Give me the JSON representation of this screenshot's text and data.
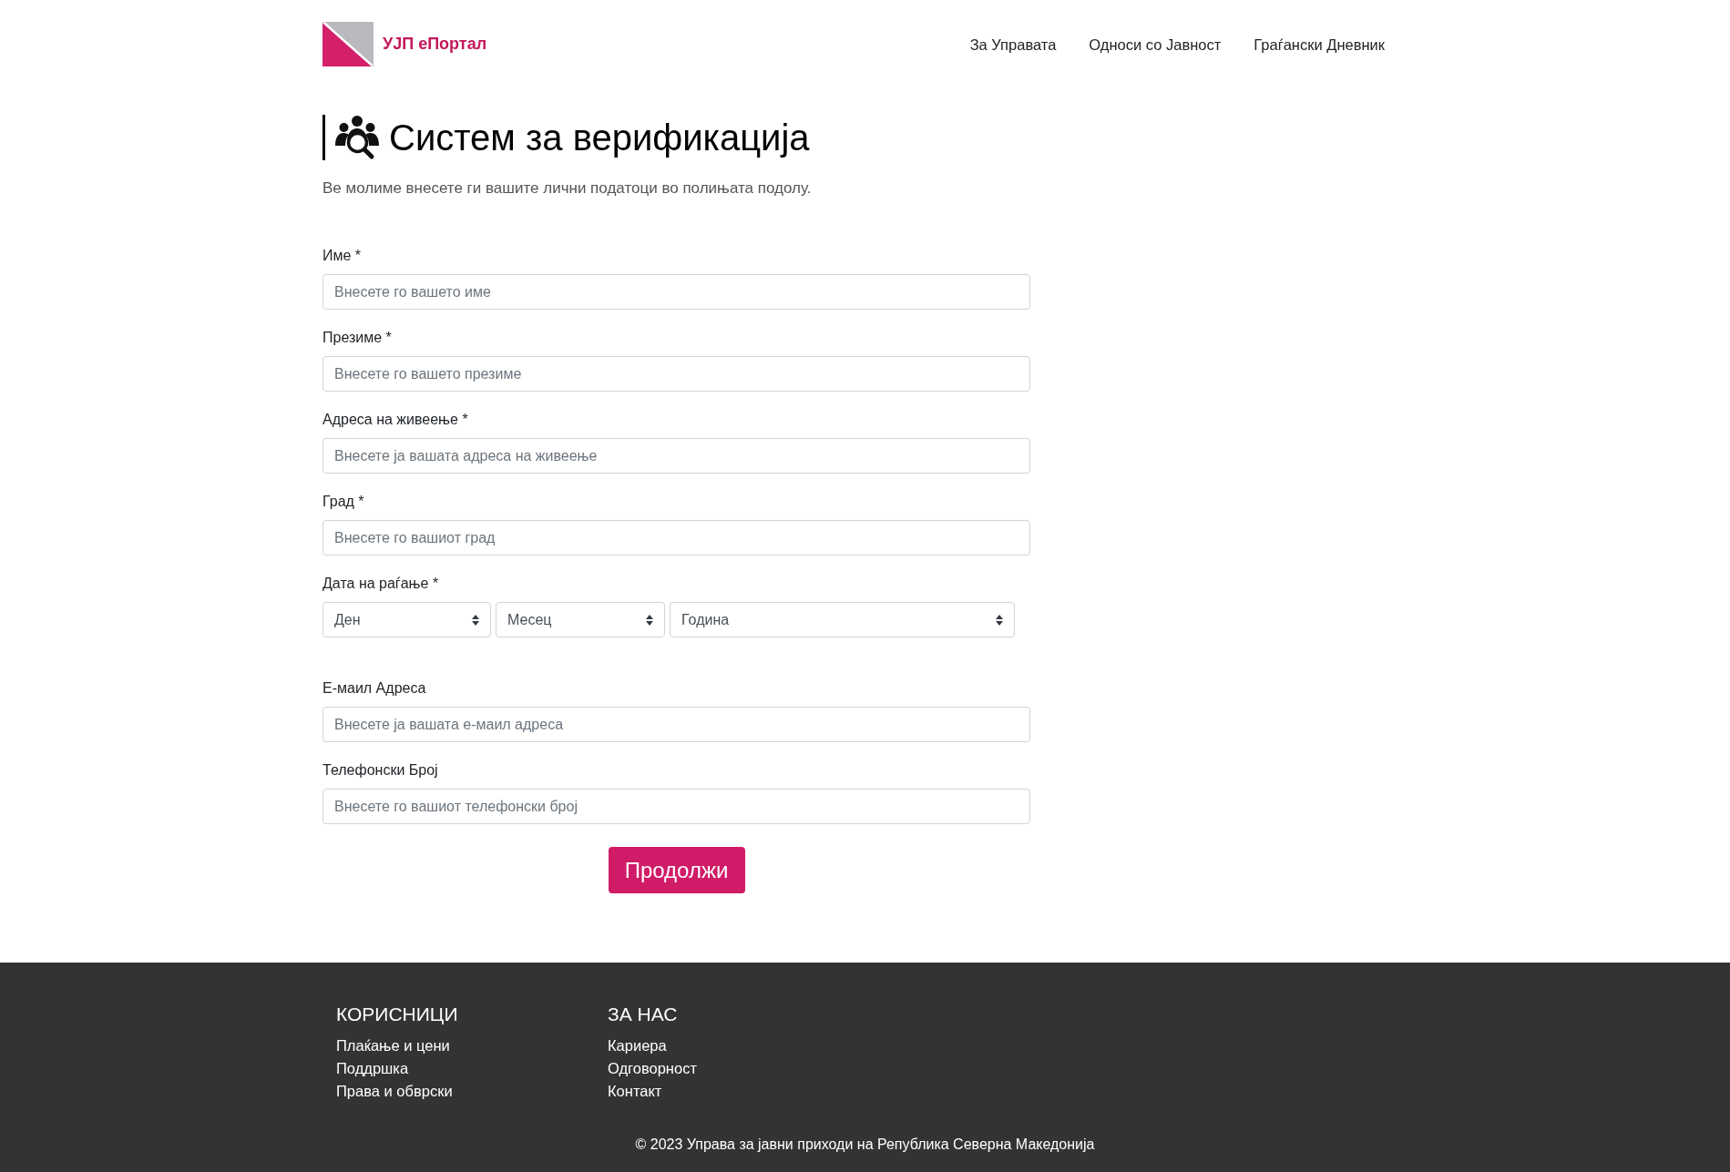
{
  "header": {
    "brand": "УЈП еПортал",
    "nav": [
      {
        "label": "За Управата"
      },
      {
        "label": "Односи со Јавност"
      },
      {
        "label": "Граѓански Дневник"
      }
    ]
  },
  "page": {
    "title": "Систем за верификација",
    "subtitle": "Ве молиме внесете ги вашите лични податоци во полињата подолу."
  },
  "form": {
    "fields": [
      {
        "kind": "text",
        "label": "Име *",
        "placeholder": "Внесете го вашето име"
      },
      {
        "kind": "text",
        "label": "Презиме *",
        "placeholder": "Внесете го вашето презиме"
      },
      {
        "kind": "text",
        "label": "Адреса на живеење *",
        "placeholder": "Внесете ја вашата адреса на живеење"
      },
      {
        "kind": "text",
        "label": "Град *",
        "placeholder": "Внесете го вашиот град"
      },
      {
        "kind": "date",
        "label": "Дата на раѓање *",
        "selects": [
          {
            "placeholder": "Ден"
          },
          {
            "placeholder": "Месец"
          },
          {
            "placeholder": "Година"
          }
        ]
      },
      {
        "kind": "text",
        "label": "Е-маил Адреса",
        "placeholder": "Внесете ја вашата е-маил адреса"
      },
      {
        "kind": "text",
        "label": "Телефонски Број",
        "placeholder": "Внесете го вашиот телефонски број"
      }
    ],
    "submit": "Продолжи"
  },
  "footer": {
    "columns": [
      {
        "heading": "КОРИСНИЦИ",
        "links": [
          "Плаќање и цени",
          "Поддршка",
          "Права и обврски"
        ]
      },
      {
        "heading": "ЗА НАС",
        "links": [
          "Кариера",
          "Одговорност",
          "Контакт"
        ]
      }
    ],
    "copyright": "© 2023 Управа за јавни приходи на Република Северна Македонија"
  }
}
